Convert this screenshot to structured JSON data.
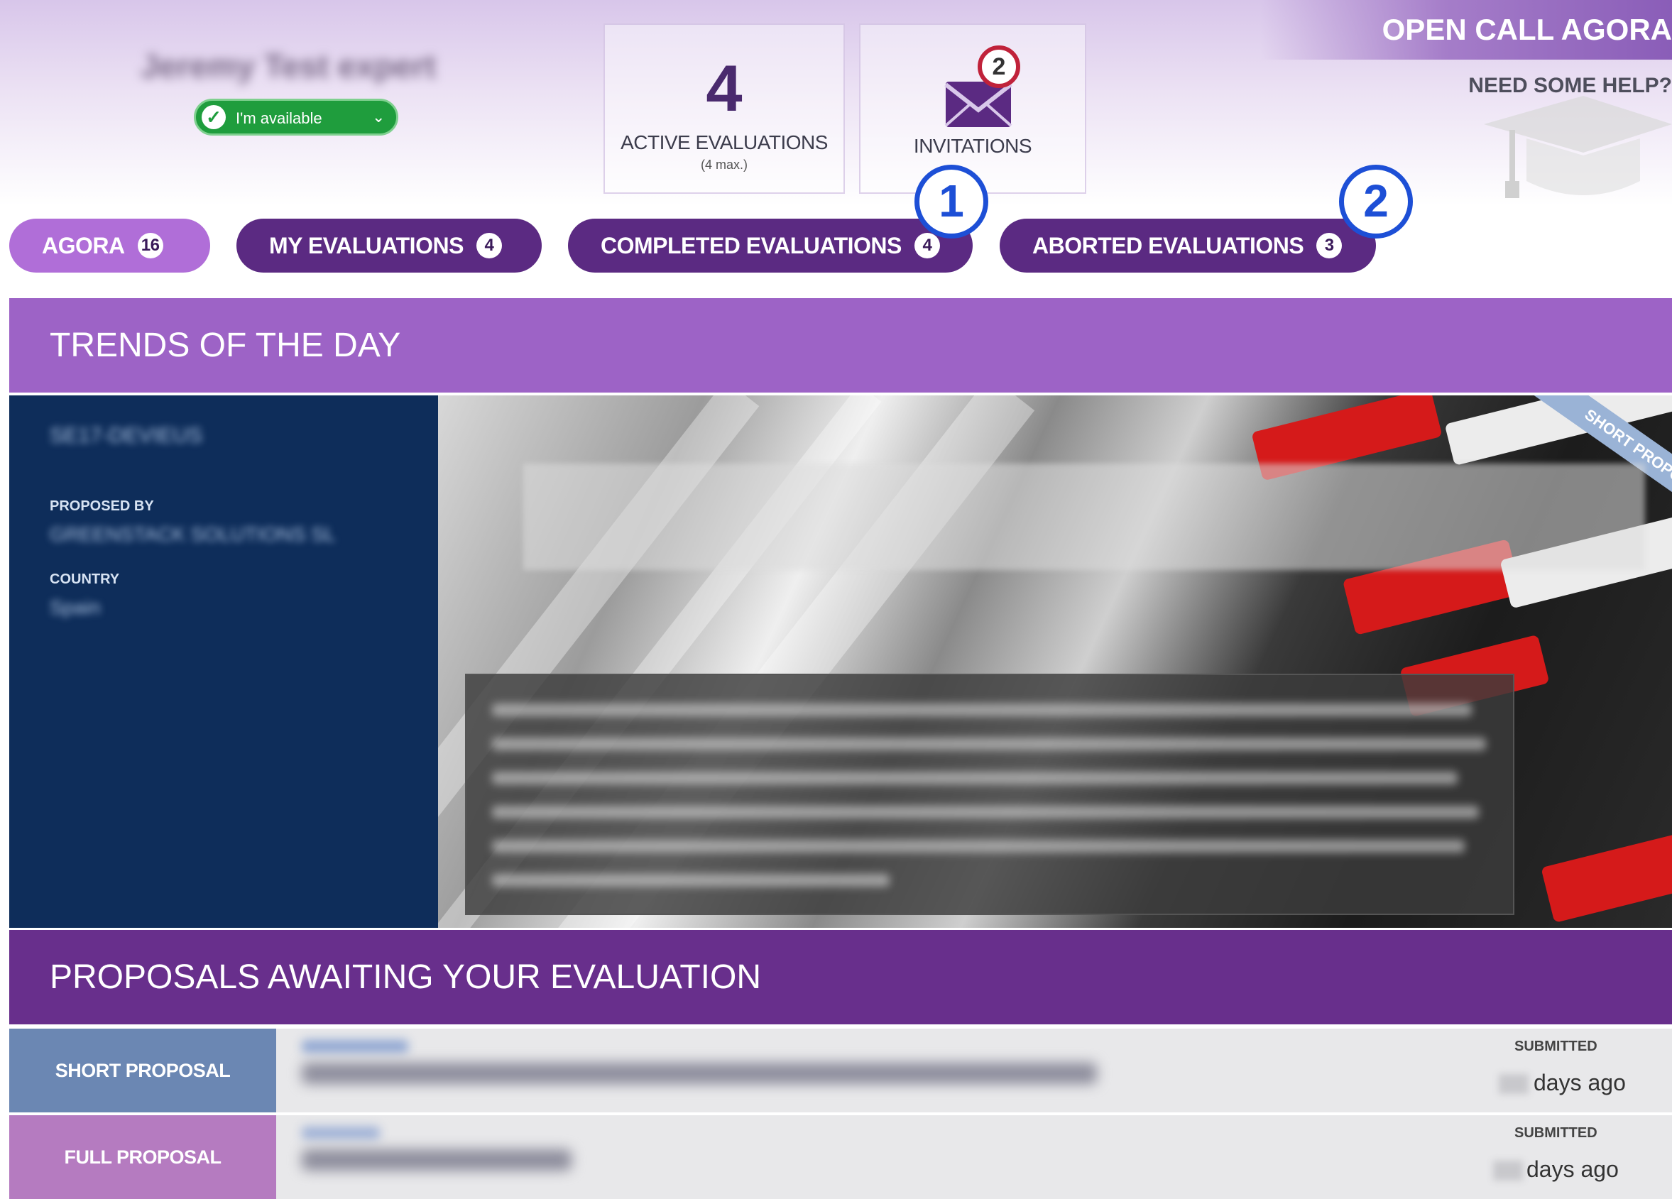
{
  "header": {
    "user_name": "Jeremy Test expert",
    "availability": "I'm available",
    "brand_title": "OPEN CALL AGORA",
    "help_link": "NEED SOME HELP?",
    "active_evaluations": {
      "count": "4",
      "label": "ACTIVE EVALUATIONS",
      "sub": "(4 max.)"
    },
    "invitations": {
      "label": "INVITATIONS",
      "badge": "2"
    }
  },
  "tabs": [
    {
      "label": "AGORA",
      "count": "16",
      "active": true
    },
    {
      "label": "MY EVALUATIONS",
      "count": "4",
      "active": false
    },
    {
      "label": "COMPLETED EVALUATIONS",
      "count": "4",
      "active": false
    },
    {
      "label": "ABORTED EVALUATIONS",
      "count": "3",
      "active": false
    }
  ],
  "callouts": [
    "1",
    "2"
  ],
  "trends": {
    "title": "TRENDS OF THE DAY",
    "id_text": "SE17-DEVIEUS",
    "proposed_by_label": "PROPOSED BY",
    "proposed_by_value": "GREENSTACK SOLUTIONS SL",
    "country_label": "COUNTRY",
    "country_value": "Spain",
    "ribbon": "SHORT PROPOSAL"
  },
  "proposals": {
    "title": "PROPOSALS AWAITING YOUR EVALUATION",
    "rows": [
      {
        "type": "SHORT PROPOSAL",
        "submitted_label": "SUBMITTED",
        "days_label": "days ago"
      },
      {
        "type": "FULL PROPOSAL",
        "submitted_label": "SUBMITTED",
        "days_label": "days ago"
      }
    ]
  },
  "colors": {
    "tab": "#5b2a82",
    "tab_active": "#b06ed8",
    "trends_bar": "#9d63c6",
    "proposals_bar": "#682f8c",
    "short_proposal": "#6b87b3",
    "full_proposal": "#b57bc0",
    "callout": "#1d4fd6"
  }
}
